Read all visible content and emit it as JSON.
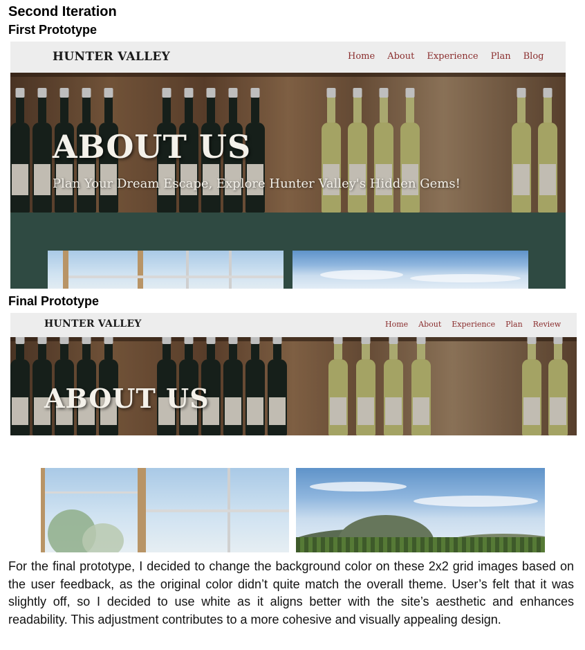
{
  "headings": {
    "iteration": "Second Iteration",
    "first": "First Prototype",
    "final": "Final Prototype"
  },
  "first_prototype": {
    "brand": "HUNTER VALLEY",
    "nav": [
      "Home",
      "About",
      "Experience",
      "Plan",
      "Blog"
    ],
    "hero_title": "ABOUT US",
    "hero_subtitle": "Plan Your Dream Escape, Explore Hunter Valley's Hidden Gems!",
    "section_bg_color": "#2f4a42",
    "nav_bg_color": "#ededed",
    "nav_link_color": "#8a2d2d"
  },
  "final_prototype": {
    "brand": "HUNTER VALLEY",
    "nav": [
      "Home",
      "About",
      "Experience",
      "Plan",
      "Review"
    ],
    "hero_title": "ABOUT US",
    "section_bg_color": "#ffffff",
    "nav_bg_color": "#ededed",
    "nav_link_color": "#8a2d2d"
  },
  "description": "For the final prototype, I decided to change the background color on these 2x2 grid images based on the user feedback, as the original color didn’t quite match the overall theme. User’s felt that it was slightly off, so I decided to use white as it aligns better with the site’s aesthetic and enhances readability. This adjustment contributes to a more cohesive and visually appealing design."
}
